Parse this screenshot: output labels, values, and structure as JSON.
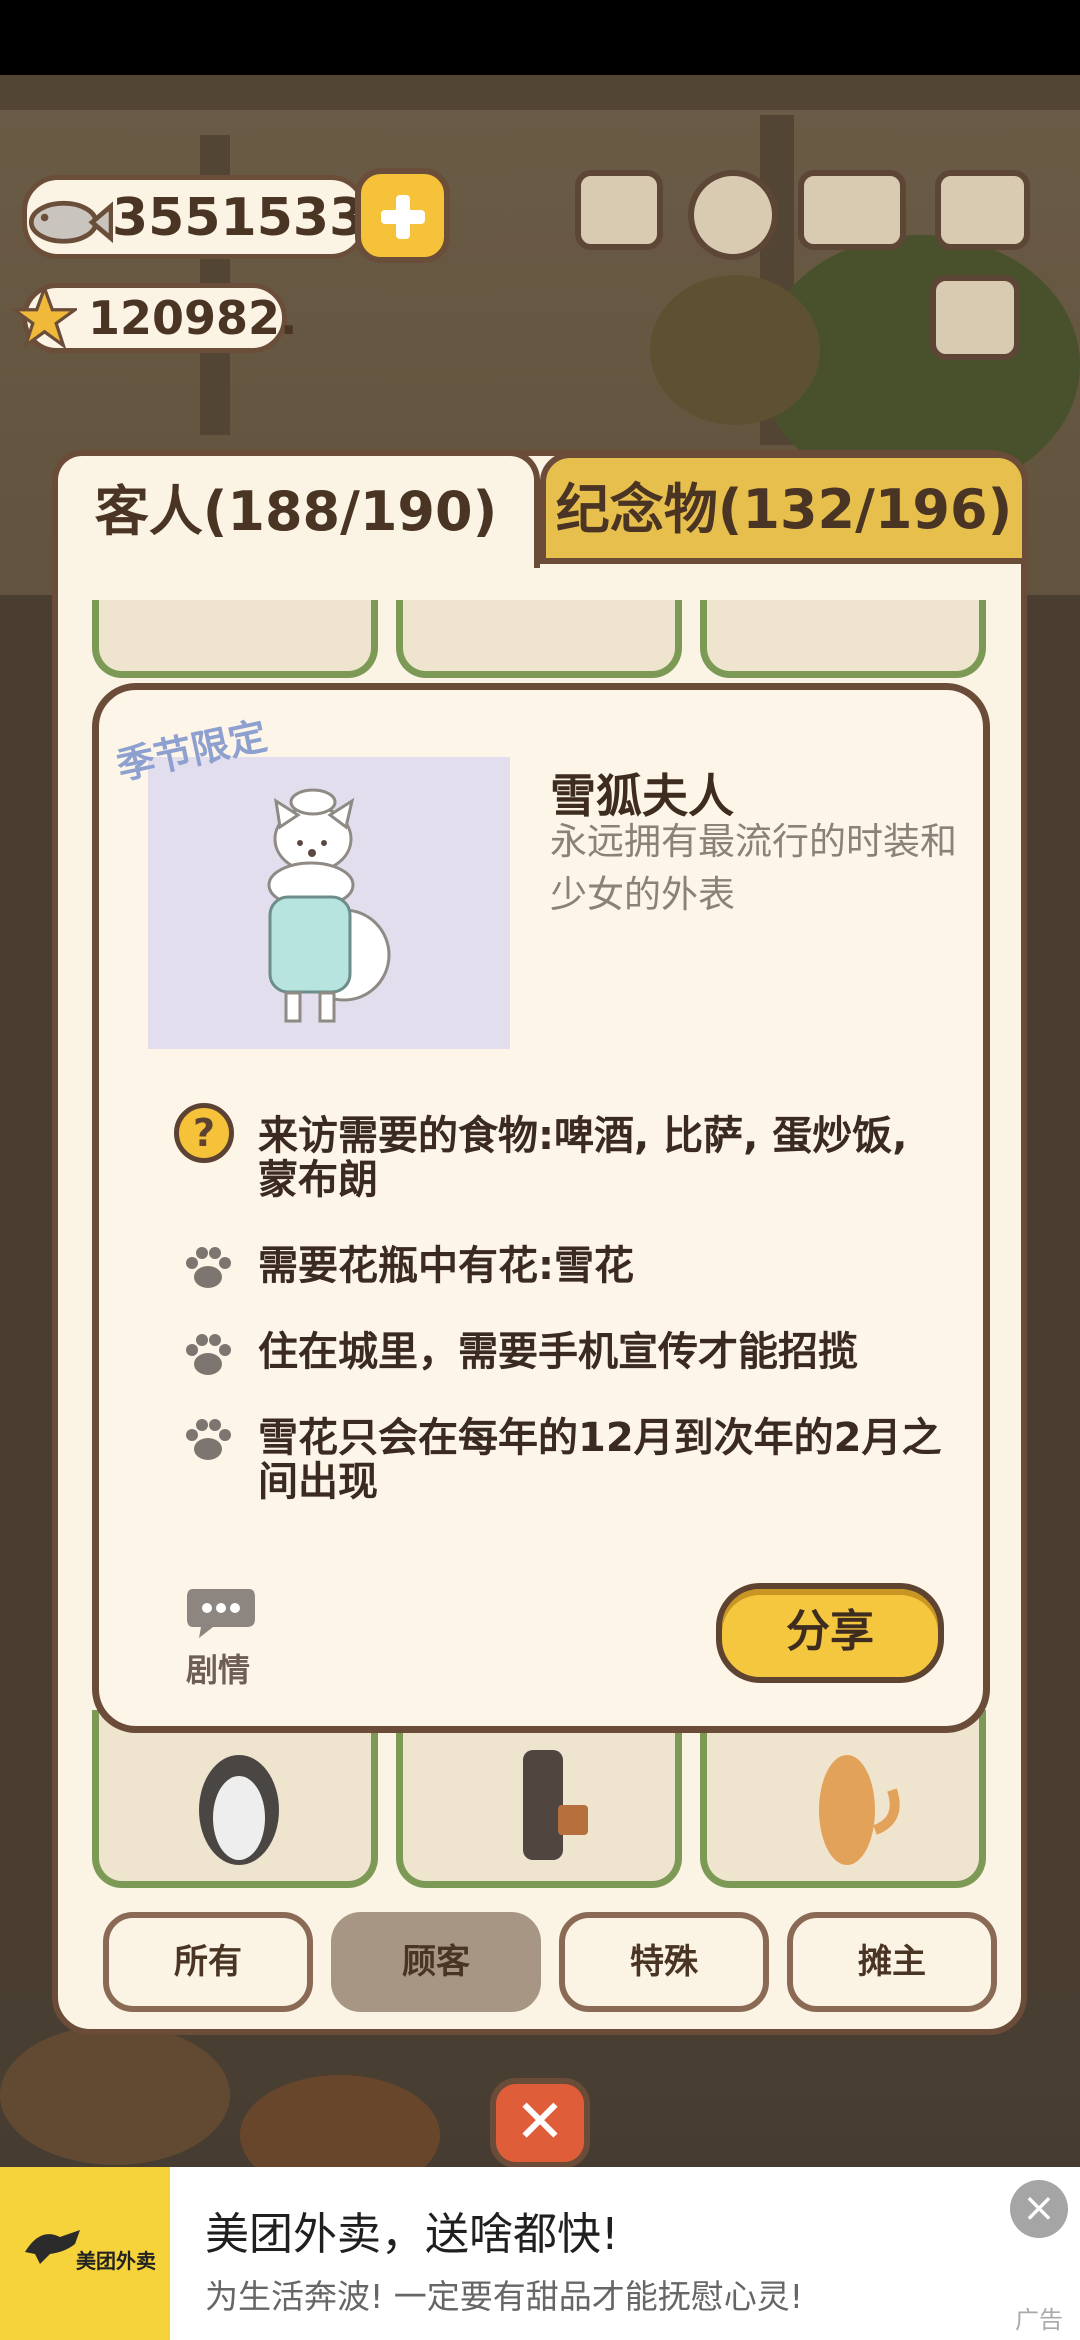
{
  "hud": {
    "fish_count": "3551533",
    "star_count": "120982."
  },
  "tabs": {
    "guests": "客人(188/190)",
    "souvenirs": "纪念物(132/196)"
  },
  "detail": {
    "season_tag": "季节限定",
    "name": "雪狐夫人",
    "description": "永远拥有最流行的时装和少女的外表",
    "requirements": [
      "来访需要的食物:啤酒, 比萨, 蛋炒饭, 蒙布朗",
      "需要花瓶中有花:雪花",
      "住在城里，需要手机宣传才能招揽",
      "雪花只会在每年的12月到次年的2月之间出现"
    ],
    "story_label": "剧情",
    "share_label": "分享"
  },
  "filters": [
    "所有",
    "顾客",
    "特殊",
    "摊主"
  ],
  "active_filter": "顾客",
  "ad": {
    "brand": "美团外卖",
    "title": "美团外卖，送啥都快!",
    "subtitle": "为生活奔波! 一定要有甜品才能抚慰心灵!",
    "tag": "广告"
  },
  "colors": {
    "panel_bg": "#fbf3e4",
    "border_brown": "#6a4c38",
    "gold": "#f4c73e",
    "card_green": "#7c9a55"
  }
}
